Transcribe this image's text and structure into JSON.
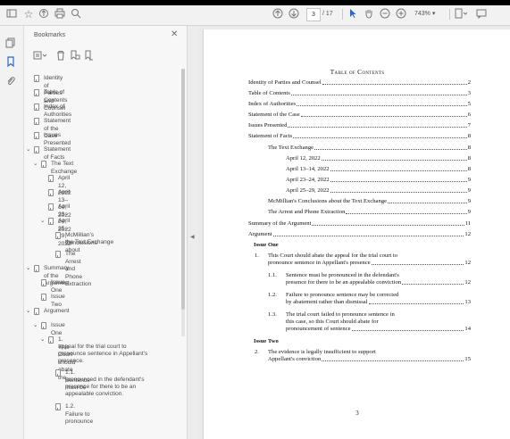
{
  "toolbar": {
    "page_current": "3",
    "page_total": "/ 17",
    "zoom": "743% ▾"
  },
  "panel": {
    "title": "Bookmarks",
    "close": "✕"
  },
  "bookmarks": [
    {
      "label": "Identity of Parties and Counsel"
    },
    {
      "label": "Table of Contents"
    },
    {
      "label": "Index of Authorities"
    },
    {
      "label": "Statement of the Case"
    },
    {
      "label": "Issues Presented"
    },
    {
      "label": "Statement of Facts"
    },
    {
      "label": "The Text Exchange"
    },
    {
      "label": "April 12, 2022"
    },
    {
      "label": "April 13–14, 2022"
    },
    {
      "label": "April 23–24, 2022"
    },
    {
      "label": "April 25–29, 2022"
    },
    {
      "label": "McMillian's Conclusions about"
    },
    {
      "label": "the Text Exchange"
    },
    {
      "label": "The Arrest and Phone Extraction"
    },
    {
      "label": "Summary of the Argument"
    },
    {
      "label": "Issue One"
    },
    {
      "label": "Issue Two"
    },
    {
      "label": "Argument"
    },
    {
      "label": "Issue One"
    },
    {
      "label": "1. This Court should abate the"
    },
    {
      "label": "appeal for the trial court to"
    },
    {
      "label": "pronounce sentence in Appellant's"
    },
    {
      "label": "presence."
    },
    {
      "label": "1.1. Sentence must be"
    },
    {
      "label": "pronounced in the defendant's"
    },
    {
      "label": "presence for there to be an"
    },
    {
      "label": "appealable conviction."
    },
    {
      "label": "1.2. Failure to pronounce"
    }
  ],
  "document": {
    "title": "Table of Contents",
    "entries": [
      {
        "label": "Identity of Parties and Counsel",
        "page": "2"
      },
      {
        "label": "Table of Contents",
        "page": "3"
      },
      {
        "label": "Index of Authorities",
        "page": "5"
      },
      {
        "label": "Statement of the Case",
        "page": "6"
      },
      {
        "label": "Issues Presented",
        "page": "7"
      },
      {
        "label": "Statement of Facts",
        "page": "8"
      },
      {
        "label": "The Text Exchange",
        "page": "8"
      },
      {
        "label": "April 12, 2022",
        "page": "8"
      },
      {
        "label": "April 13–14, 2022",
        "page": "8"
      },
      {
        "label": "April 23–24, 2022",
        "page": "9"
      },
      {
        "label": "April 25–29, 2022",
        "page": "9"
      },
      {
        "label": "McMillian's Conclusions about the Text Exchange",
        "page": "9"
      },
      {
        "label": "The Arrest and Phone Extraction",
        "page": "9"
      },
      {
        "label": "Summary of the Argument",
        "page": "11"
      },
      {
        "label": "Argument",
        "page": "12"
      }
    ],
    "issue_one": "Issue One",
    "item1": {
      "num": "1.",
      "line1": "This Court should abate the appeal for the trial court to",
      "line2": "pronounce sentence in Appellant's presence",
      "page": "12"
    },
    "item11": {
      "num": "1.1.",
      "line1": "Sentence must be pronounced in the defendant's",
      "line2": "presence for there to be an appealable conviction",
      "page": "12"
    },
    "item12": {
      "num": "1.2.",
      "line1": "Failure to pronounce sentence may be corrected",
      "line2": "by abatement rather than dismissal",
      "page": "13"
    },
    "item13": {
      "num": "1.3.",
      "line1": "The trial court failed to pronounce sentence in",
      "line2": "this case, so this Court should abate for",
      "line3": "pronouncement of sentence",
      "page": "14"
    },
    "issue_two": "Issue Two",
    "item2": {
      "num": "2.",
      "line1": "The evidence is legally insufficient to support",
      "line2": "Appellant's conviction",
      "page": "15"
    },
    "page_number": "3"
  }
}
